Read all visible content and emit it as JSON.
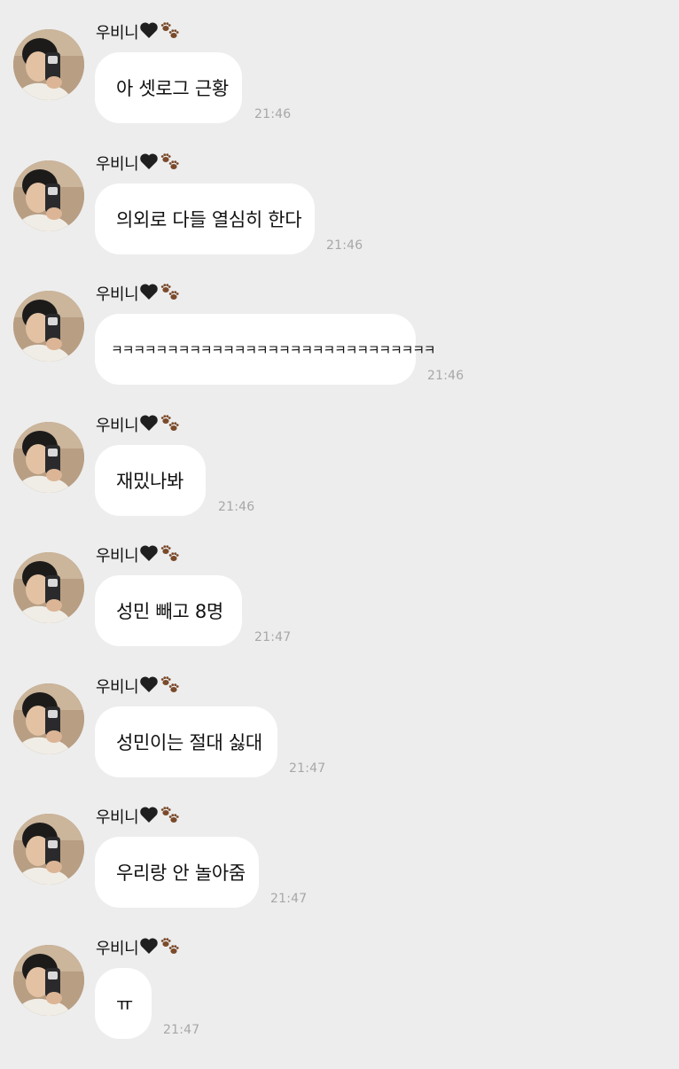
{
  "sender": {
    "name": "우비니"
  },
  "messages": [
    {
      "text": "아 셋로그 근황",
      "time": "21:46"
    },
    {
      "text": "의외로 다들 열심히 한다",
      "time": "21:46"
    },
    {
      "text": "ㅋㅋㅋㅋㅋㅋㅋㅋㅋㅋㅋㅋㅋㅋㅋㅋㅋㅋㅋㅋㅋㅋㅋㅋㅋㅋㅋㅋㅋ",
      "time": "21:46"
    },
    {
      "text": "재밌나봐",
      "time": "21:46"
    },
    {
      "text": "성민 빼고 8명",
      "time": "21:47"
    },
    {
      "text": "성민이는 절대 싫대",
      "time": "21:47"
    },
    {
      "text": "우리랑 안 놀아줌",
      "time": "21:47"
    },
    {
      "text": "ㅠ",
      "time": "21:47"
    }
  ],
  "colors": {
    "background": "#ededed",
    "bubble": "#ffffff",
    "timestamp": "#a7a7a7",
    "heart": "#1f1f1f",
    "paw": "#7a4a2a"
  }
}
